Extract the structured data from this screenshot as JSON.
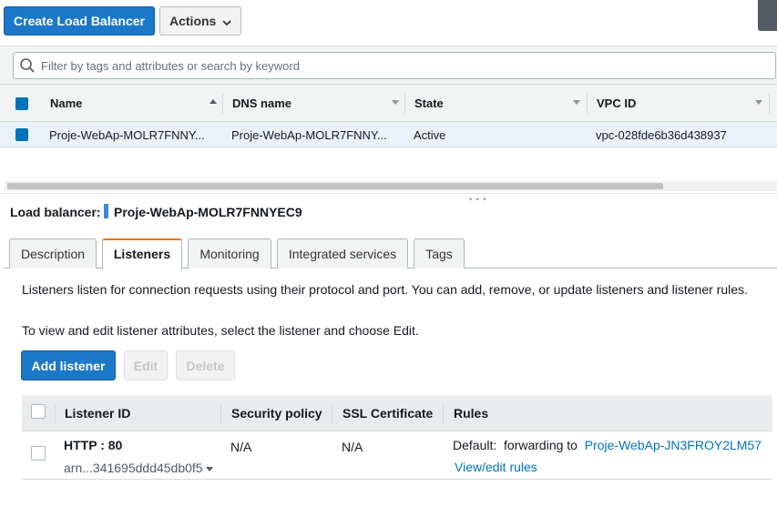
{
  "toolbar": {
    "create_label": "Create Load Balancer",
    "actions_label": "Actions"
  },
  "filter": {
    "placeholder": "Filter by tags and attributes or search by keyword"
  },
  "grid": {
    "columns": [
      "Name",
      "DNS name",
      "State",
      "VPC ID"
    ],
    "rows": [
      {
        "name": "Proje-WebAp-MOLR7FNNY...",
        "dns": "Proje-WebAp-MOLR7FNNY...",
        "state": "Active",
        "vpc": "vpc-028fde6b36d438937"
      }
    ]
  },
  "details": {
    "label": "Load balancer:",
    "name": "Proje-WebAp-MOLR7FNNYEC9",
    "tabs": [
      "Description",
      "Listeners",
      "Monitoring",
      "Integrated services",
      "Tags"
    ],
    "active_tab": "Listeners"
  },
  "listeners": {
    "intro": "Listeners listen for connection requests using their protocol and port. You can add, remove, or update listeners and listener rules.",
    "hint": "To view and edit listener attributes, select the listener and choose Edit.",
    "buttons": {
      "add": "Add listener",
      "edit": "Edit",
      "delete": "Delete"
    },
    "columns": [
      "Listener ID",
      "Security policy",
      "SSL Certificate",
      "Rules"
    ],
    "rows": [
      {
        "id": "HTTP : 80",
        "arn": "arn...341695ddd45db0f5",
        "security_policy": "N/A",
        "ssl_certificate": "N/A",
        "rule_prefix": "Default:",
        "rule_action": "forwarding to",
        "rule_target": "Proje-WebAp-JN3FROY2LM57",
        "rule_link": "View/edit rules"
      }
    ]
  },
  "colors": {
    "primary": "#1b78c8",
    "accent_tab": "#ec7211",
    "link": "#0073bb",
    "selected_row": "#eaf3fb"
  }
}
